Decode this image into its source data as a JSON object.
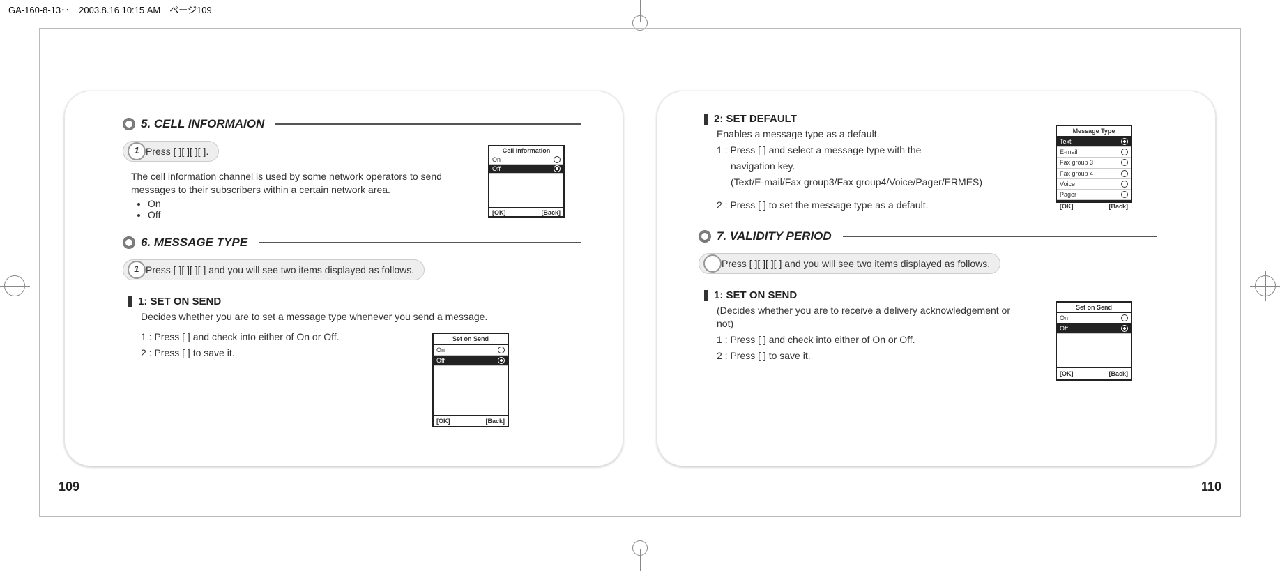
{
  "print_mark": "GA-160-8-13･･　2003.8.16 10:15 AM　ページ109",
  "left": {
    "page_number": "109",
    "sec5": {
      "title": "5. CELL INFORMAION",
      "step": "Press [   ][   ][   ][   ].",
      "step_num": "1",
      "body": "The cell information channel is used by some network operators to send messages to their subscribers within a certain network area.",
      "bullets": [
        "On",
        "Off"
      ]
    },
    "sec6": {
      "title": "6. MESSAGE TYPE",
      "step": "Press [   ][   ][   ][   ] and you will see two items displayed as follows.",
      "step_num": "1",
      "sub1_title": "1: SET ON SEND",
      "sub1_body": "Decides whether you are to set a message type whenever you send a message.",
      "row1": "1 : Press [     ] and check into either of On or Off.",
      "row2": "2 : Press [     ] to save it."
    },
    "screens": {
      "cell": {
        "title": "Cell Information",
        "on": "On",
        "off": "Off",
        "ok": "[OK]",
        "back": "[Back]"
      },
      "setOnSend": {
        "title": "Set on Send",
        "on": "On",
        "off": "Off",
        "ok": "[OK]",
        "back": "[Back]"
      }
    }
  },
  "right": {
    "page_number": "110",
    "sec2d": {
      "title": "2: SET DEFAULT",
      "body": "Enables a message type as a default.",
      "row1a": "1 : Press [     ] and select a message type with the",
      "row1b": "navigation key.",
      "row1c": "(Text/E-mail/Fax group3/Fax group4/Voice/Pager/ERMES)",
      "row2": "2 : Press [     ] to set the message type as a default."
    },
    "sec7": {
      "title": "7. VALIDITY PERIOD",
      "step": "Press [   ][   ][   ][   ] and you will see two items displayed as follows.",
      "sub1_title": "1: SET ON SEND",
      "sub1_body": "(Decides whether you are to receive a delivery acknowledgement or not)",
      "row1": "1 : Press [     ] and check into either of On or Off.",
      "row2": "2 : Press [     ] to  save it."
    },
    "screens": {
      "msgType": {
        "title": "Message Type",
        "i1": "Text",
        "i2": "E-mail",
        "i3": "Fax group 3",
        "i4": "Fax group 4",
        "i5": "Voice",
        "i6": "Pager",
        "ok": "[OK]",
        "back": "[Back]"
      },
      "setOnSend": {
        "title": "Set on Send",
        "on": "On",
        "off": "Off",
        "ok": "[OK]",
        "back": "[Back]"
      }
    }
  }
}
